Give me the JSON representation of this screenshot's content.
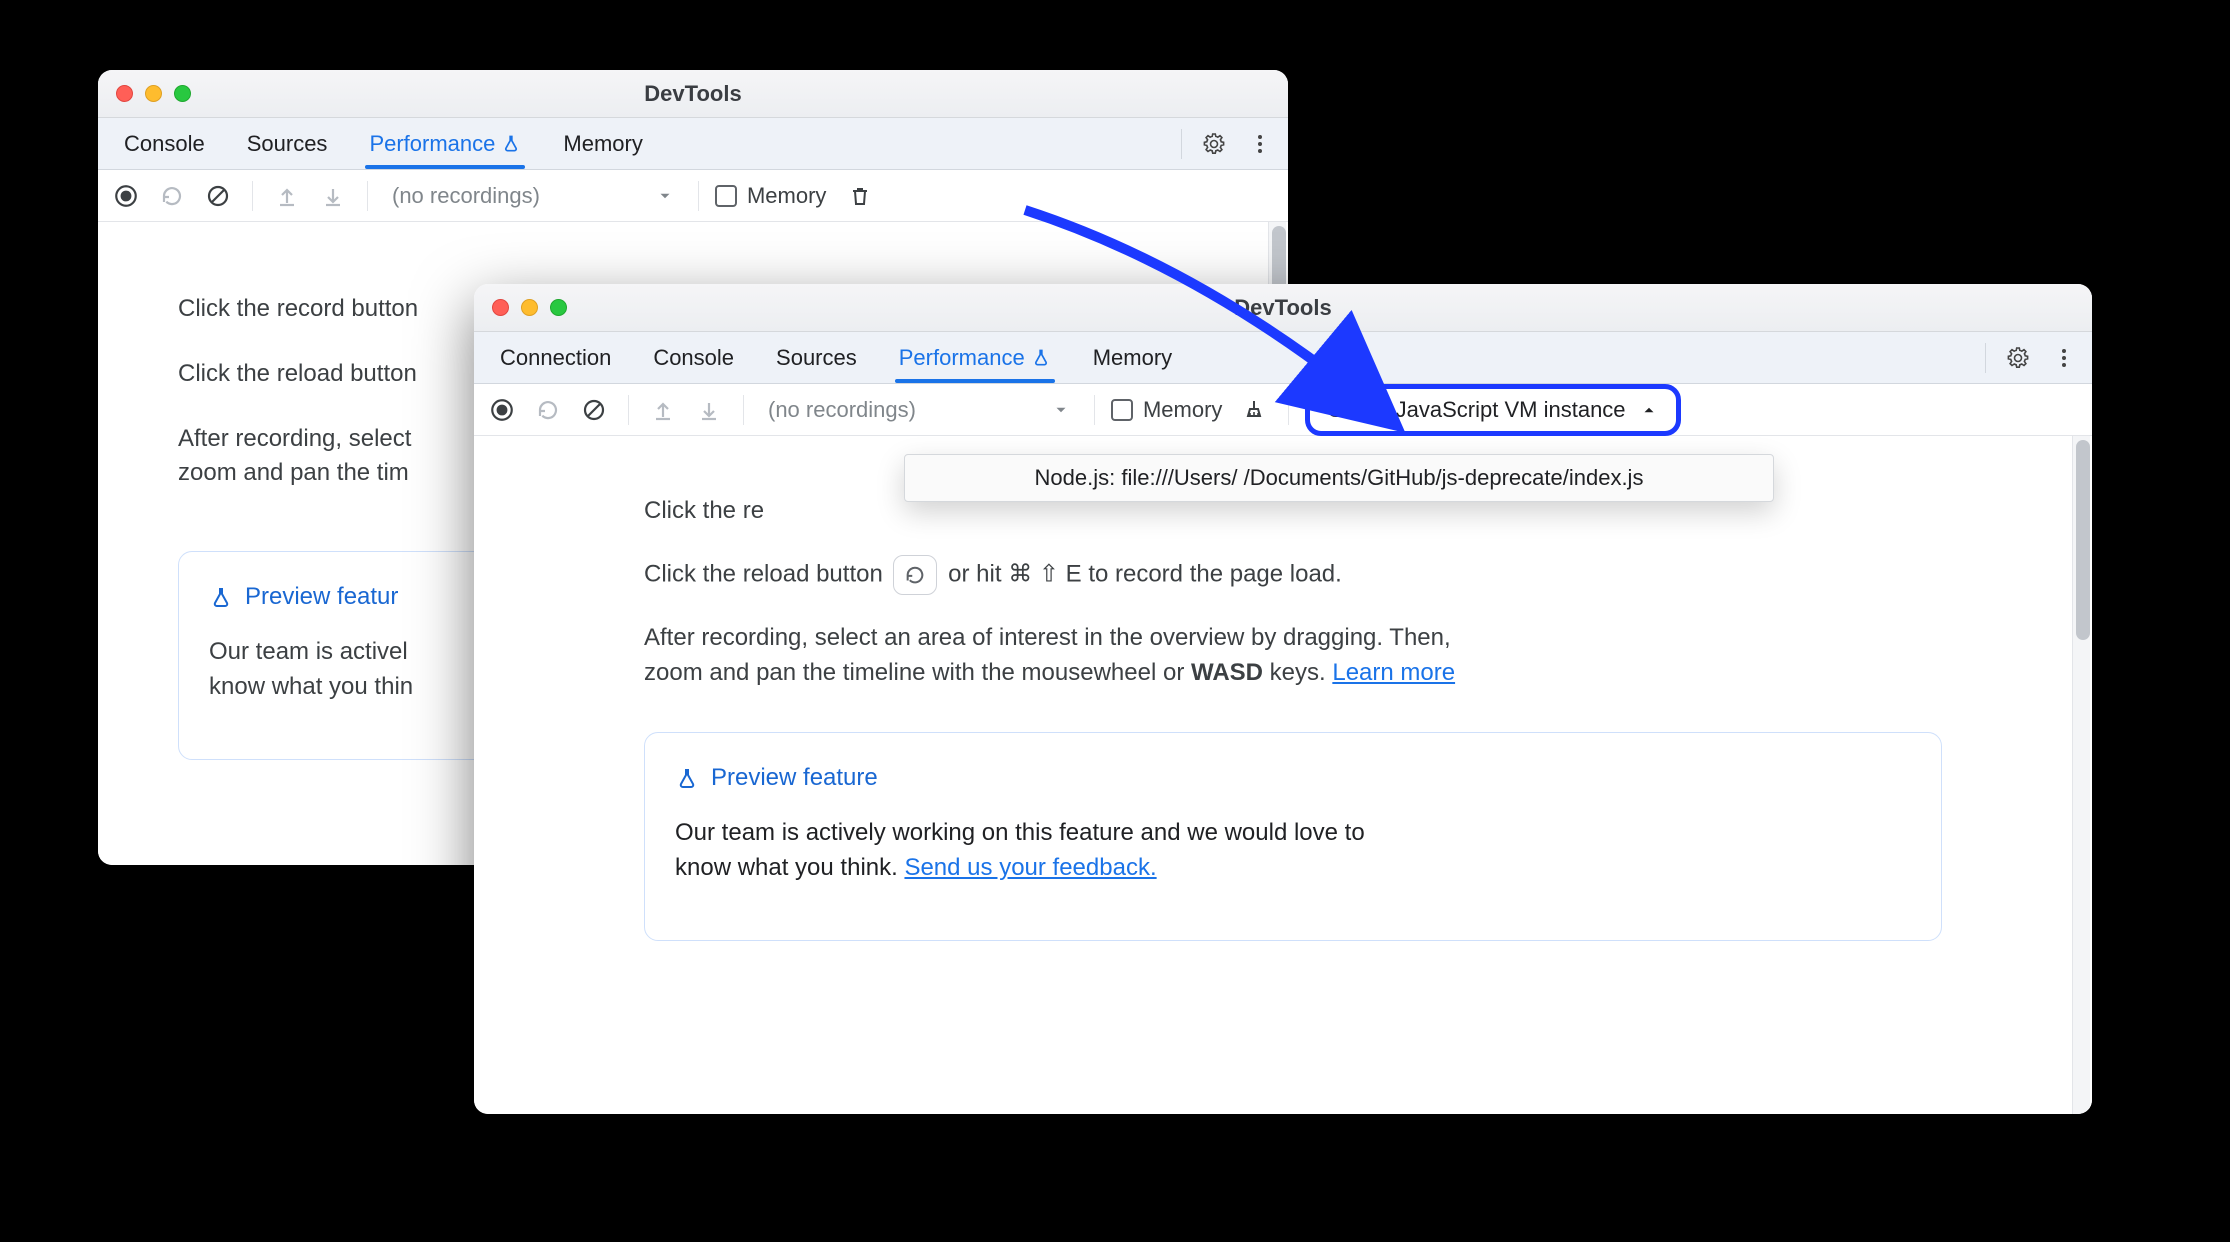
{
  "back": {
    "title": "DevTools",
    "tabs": [
      "Console",
      "Sources",
      "Performance",
      "Memory"
    ],
    "active_tab": "Performance",
    "recordings_placeholder": "(no recordings)",
    "memory_label": "Memory",
    "hint_record_prefix": "Click the record button",
    "hint_reload_prefix": "Click the reload button",
    "hint_after_1": "After recording, select",
    "hint_after_2": "zoom and pan the tim",
    "preview_title": "Preview featur",
    "preview_body_1": "Our team is activel",
    "preview_body_2": "know what you thin"
  },
  "front": {
    "title": "DevTools",
    "tabs": [
      "Connection",
      "Console",
      "Sources",
      "Performance",
      "Memory"
    ],
    "active_tab": "Performance",
    "recordings_placeholder": "(no recordings)",
    "memory_label": "Memory",
    "vm_select_label": "Select JavaScript VM instance",
    "menu_item": "Node.js: file:///Users/        /Documents/GitHub/js-deprecate/index.js",
    "hint_record_prefix": "Click the re",
    "hint_reload_prefix": "Click the reload button ",
    "hint_reload_suffix_1": " or hit ",
    "hint_reload_sym": "⌘ ⇧ E",
    "hint_reload_suffix_2": " to record the page load.",
    "hint_after_1": "After recording, select an area of interest in the overview by dragging. Then,",
    "hint_after_2a": "zoom and pan the timeline with the mousewheel or ",
    "hint_after_wasd": "WASD",
    "hint_after_2b": " keys. ",
    "learn_more": "Learn more",
    "preview_title": "Preview feature",
    "preview_body_1": "Our team is actively working on this feature and we would love to",
    "preview_body_2a": "know what you think. ",
    "preview_feedback": "Send us your feedback."
  },
  "icons": {
    "gear": "gear",
    "kebab": "kebab",
    "record": "record",
    "reload": "reload",
    "block": "block",
    "upload": "upload",
    "download": "download",
    "trash": "trash",
    "broom": "broom",
    "flask": "flask"
  }
}
